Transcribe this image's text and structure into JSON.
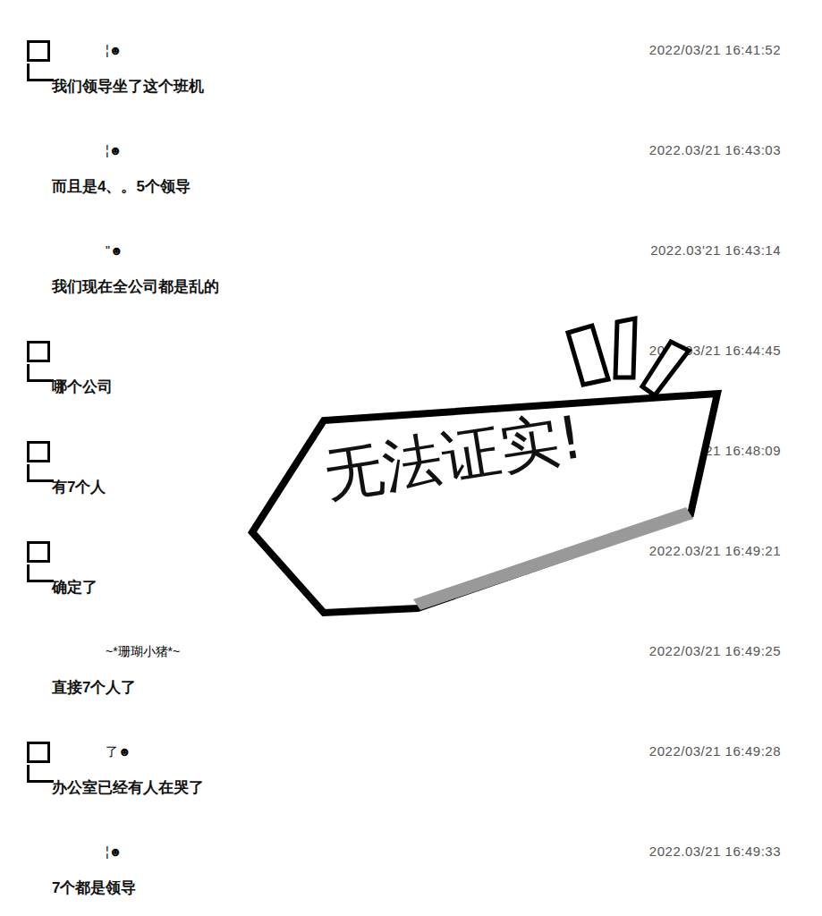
{
  "messages": [
    {
      "avatar": true,
      "name": "¦☻",
      "time": "2022/03/21 16:41:52",
      "text": "我们领导坐了这个班机"
    },
    {
      "avatar": false,
      "name": "¦☻",
      "time": "2022.03/21 16:43:03",
      "text": "而且是4、。5个领导"
    },
    {
      "avatar": false,
      "name": "\"☻",
      "time": "2022.03'21 16:43:14",
      "text": "我们现在全公司都是乱的"
    },
    {
      "avatar": true,
      "name": "",
      "time": "2022/03/21 16:44:45",
      "text": "哪个公司"
    },
    {
      "avatar": true,
      "name": "",
      "time": "2022/03/21 16:48:09",
      "text": "有7个人"
    },
    {
      "avatar": true,
      "name": "",
      "time": "2022.03/21 16:49:21",
      "text": "确定了"
    },
    {
      "avatar": false,
      "name": "~*珊瑚小猪*~",
      "time": "2022/03/21 16:49:25",
      "text": "直接7个人了"
    },
    {
      "avatar": true,
      "name": "了☻",
      "time": "2022/03/21 16:49:28",
      "text": "办公室已经有人在哭了"
    },
    {
      "avatar": false,
      "name": "¦☻",
      "time": "2022.03/21 16:49:33",
      "text": "7个都是领导"
    }
  ],
  "stamp": {
    "text": "无法证实!"
  }
}
